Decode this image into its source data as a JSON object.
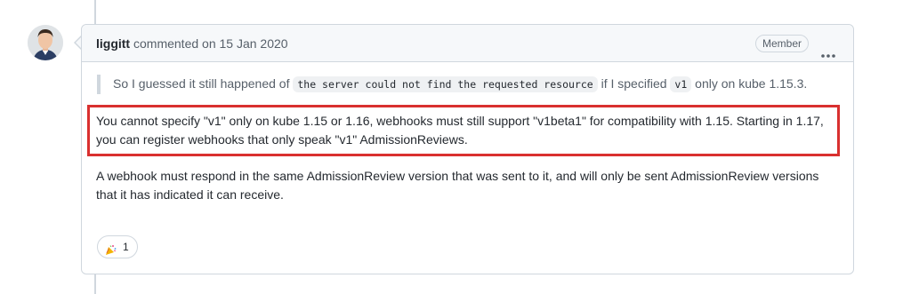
{
  "comment": {
    "author": "liggitt",
    "action": "commented on",
    "date": "15 Jan 2020",
    "badge": "Member",
    "quote": {
      "part1": "So I guessed it still happened of ",
      "code1": "the server could not find the requested resource",
      "part2": " if I specified ",
      "code2": "v1",
      "part3": " only on kube 1.15.3."
    },
    "highlighted_paragraph": "You cannot specify \"v1\" only on kube 1.15 or 1.16, webhooks must still support \"v1beta1\" for compatibility with 1.15. Starting in 1.17, you can register webhooks that only speak \"v1\" AdmissionReviews.",
    "paragraph": "A webhook must respond in the same AdmissionReview version that was sent to it, and will only be sent AdmissionReview versions that it has indicated it can receive.",
    "reaction": {
      "icon": "tada-icon",
      "count": "1"
    }
  },
  "colors": {
    "highlight_border": "#d9302f",
    "border": "#d0d7de",
    "header_bg": "#f6f8fa"
  }
}
